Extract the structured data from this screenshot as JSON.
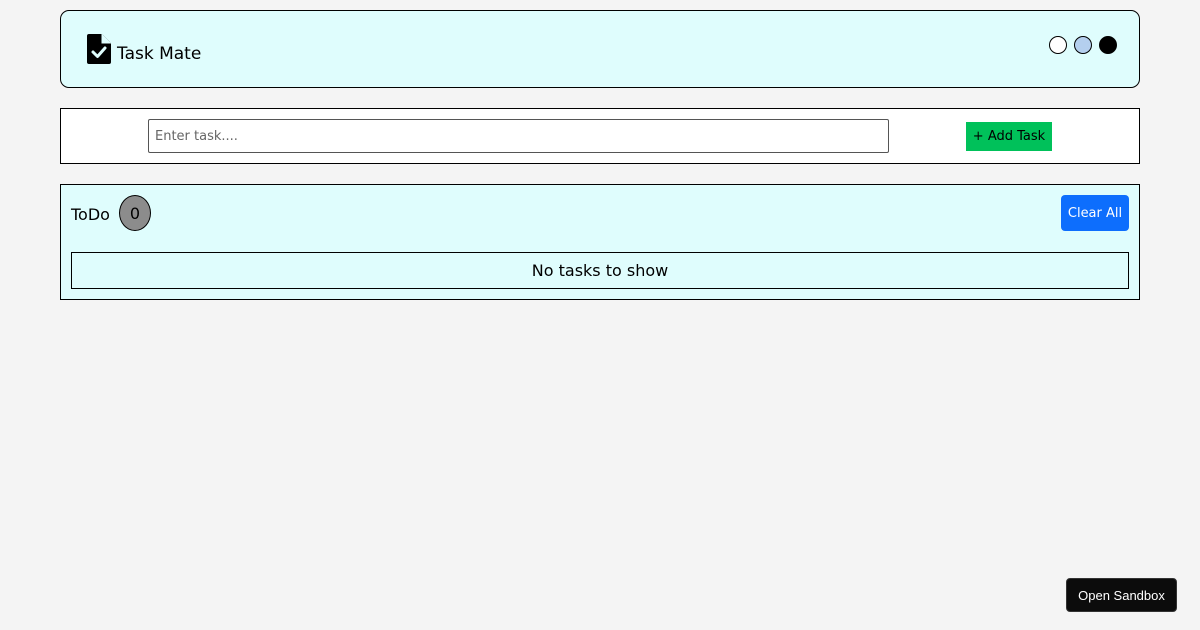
{
  "header": {
    "logo_icon": "file-check-icon",
    "title": "Task Mate",
    "theme_swatches": [
      {
        "name": "light-theme-swatch",
        "color": "#ffffff"
      },
      {
        "name": "blue-theme-swatch",
        "color": "#b4cfee"
      },
      {
        "name": "dark-theme-swatch",
        "color": "#000000"
      }
    ]
  },
  "input_bar": {
    "placeholder": "Enter task....",
    "value": "",
    "add_label": "+ Add Task",
    "add_color": "#00c15a"
  },
  "todo": {
    "title": "ToDo",
    "count": "0",
    "clear_label": "Clear All",
    "clear_color": "#0d6efd",
    "empty_message": "No tasks to show"
  },
  "sandbox": {
    "label": "Open Sandbox"
  },
  "colors": {
    "page_background": "#f4f4f4",
    "panel_background": "#dffdfd"
  }
}
